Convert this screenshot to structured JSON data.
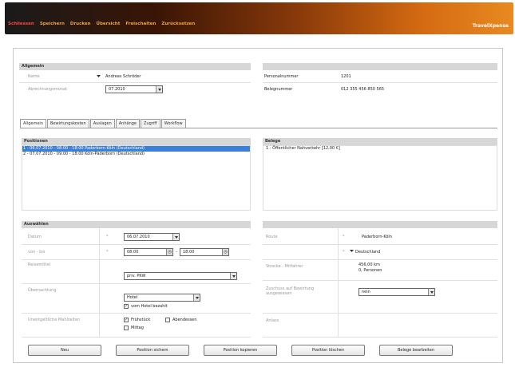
{
  "menu": {
    "items": [
      "Schliessen",
      "Speichern",
      "Drucken",
      "Übersicht",
      "Freischalten",
      "Zurücksetzen"
    ],
    "logo": "TravelXpense"
  },
  "allgemein": {
    "header": "Allgemein",
    "name_label": "Name",
    "name_value": "Andreas Schröder",
    "date_label": "Abrechnungsmonat",
    "date_value": "07.2010",
    "personal_label": "Personalnummer",
    "personal_value": "1201",
    "beleg_label": "Belegnummer",
    "beleg_value": "012 355 456 850 565"
  },
  "tabs": [
    "Allgemein",
    "Bewirtungskosten",
    "Auslagen",
    "Anhänge",
    "Zugriff",
    "Workflow"
  ],
  "positionen": {
    "header": "Positionen",
    "rows": [
      "1 - 06.07.2010 - 08:00 - 18:00 Paderborn-Köln (Deutschland)",
      "2 - 07.07.2010 - 09:00 - 18:00 Köln-Paderborn (Deutschland)"
    ]
  },
  "belege": {
    "header": "Belege",
    "rows": [
      "1 - Öffentlicher Nahverkehr [12,00 €]"
    ]
  },
  "auswahl": {
    "header": "Auswählen",
    "datum_label": "Datum",
    "datum_value": "06.07.2010",
    "von_label": "von - bis",
    "von_value": "08:00",
    "bis_value": "18:00",
    "reise_label": "Reisemittel",
    "reise_value": "priv. PKW",
    "ueber_label": "Übernachtung",
    "ueber_value": "Hotel",
    "ueber_check": "vom Hotel bezahlt",
    "mahl_label": "Unentgeltliche Mahlzeiten",
    "mahl_1": "Frühstück",
    "mahl_2": "Abendessen",
    "mahl_3": "Mittag",
    "route_label": "Route",
    "route_value": "Paderborn-Köln",
    "land_value": "Deutschland",
    "strecke_label": "Strecke - Mitfahrer",
    "strecke_value": "456,00 km",
    "mitfahrer_value": "0, Personen",
    "zuschuss_label": "Zuschuss auf Bewirtung ausgewiesen",
    "zuschuss_value": "nein",
    "anlass_label": "Anlass"
  },
  "buttons": [
    "Neu",
    "Position sichern",
    "Position kopieren",
    "Position löschen",
    "Belege bearbeiten"
  ],
  "colors": {
    "accent": "#d46a12",
    "selection": "#3b7fd8",
    "header_gray": "#d7d7d7"
  }
}
